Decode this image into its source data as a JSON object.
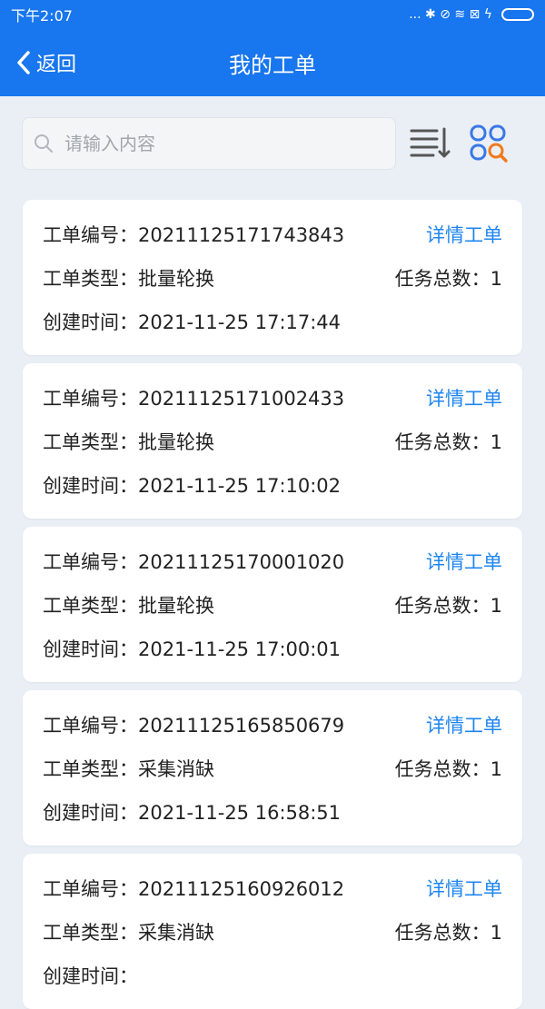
{
  "status_bar": {
    "time": "下午2:07",
    "icons": "... ✱ ⊘ ≋ ⊠ ϟ"
  },
  "nav": {
    "back_label": "返回",
    "title": "我的工单"
  },
  "search": {
    "placeholder": "请输入内容"
  },
  "labels": {
    "order_no": "工单编号：",
    "order_type": "工单类型：",
    "task_total": "任务总数：",
    "created_time": "创建时间：",
    "detail": "详情工单"
  },
  "orders": [
    {
      "no": "20211125171743843",
      "type": "批量轮换",
      "tasks": "1",
      "time": "2021-11-25 17:17:44"
    },
    {
      "no": "20211125171002433",
      "type": "批量轮换",
      "tasks": "1",
      "time": "2021-11-25 17:10:02"
    },
    {
      "no": "20211125170001020",
      "type": "批量轮换",
      "tasks": "1",
      "time": "2021-11-25 17:00:01"
    },
    {
      "no": "20211125165850679",
      "type": "采集消缺",
      "tasks": "1",
      "time": "2021-11-25 16:58:51"
    },
    {
      "no": "20211125160926012",
      "type": "采集消缺",
      "tasks": "1",
      "time": ""
    }
  ],
  "colors": {
    "primary": "#1876ee",
    "link": "#1f86ef",
    "background": "#eaeff6"
  }
}
